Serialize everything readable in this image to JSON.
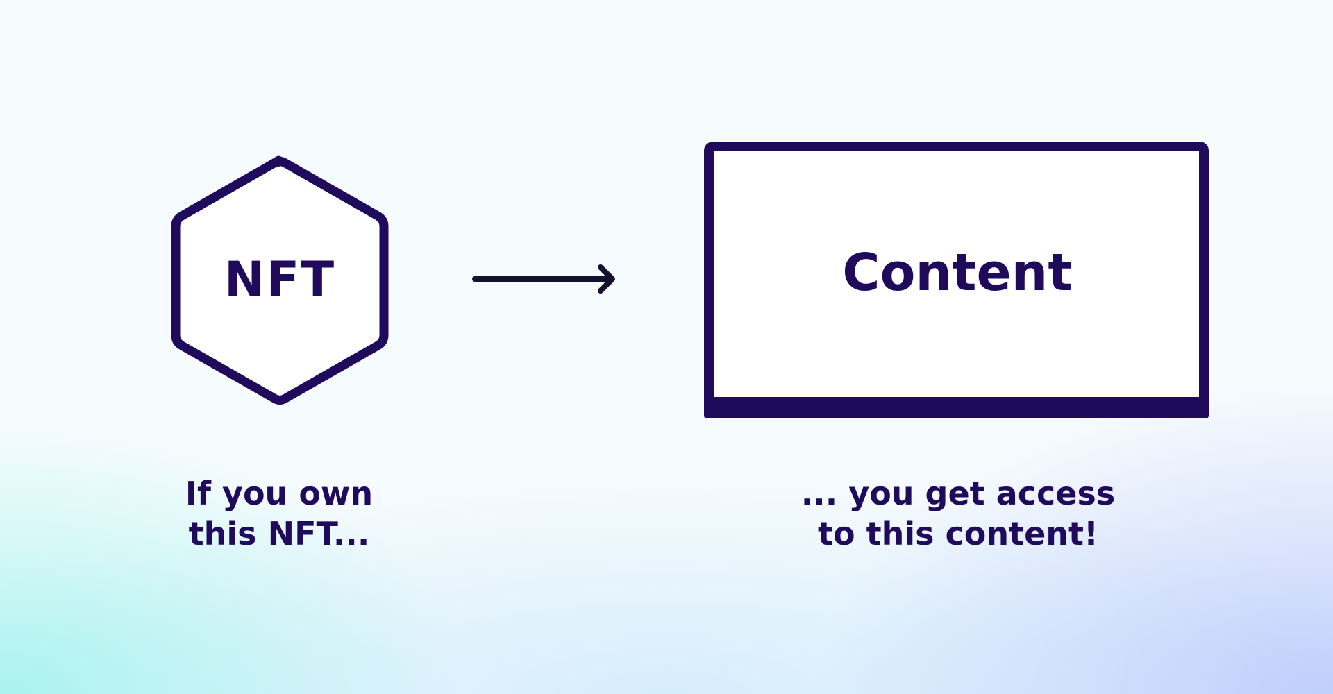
{
  "diagram": {
    "nft_label": "NFT",
    "content_label": "Content",
    "caption_left": [
      "If you own",
      "this NFT..."
    ],
    "caption_right": [
      "... you get access",
      "to this content!"
    ],
    "edge": {
      "from": "NFT",
      "to": "Content"
    }
  },
  "colors": {
    "ink": "#1f0a5c",
    "arrow": "#14102e",
    "box_fill": "#ffffff",
    "background": "#f6fbfd",
    "glow_left": "#6eeee2",
    "glow_right": "#96aafa"
  },
  "icons": {
    "nft_shape": "hexagon",
    "content_shape": "monitor-screen",
    "connector": "arrow-right"
  }
}
